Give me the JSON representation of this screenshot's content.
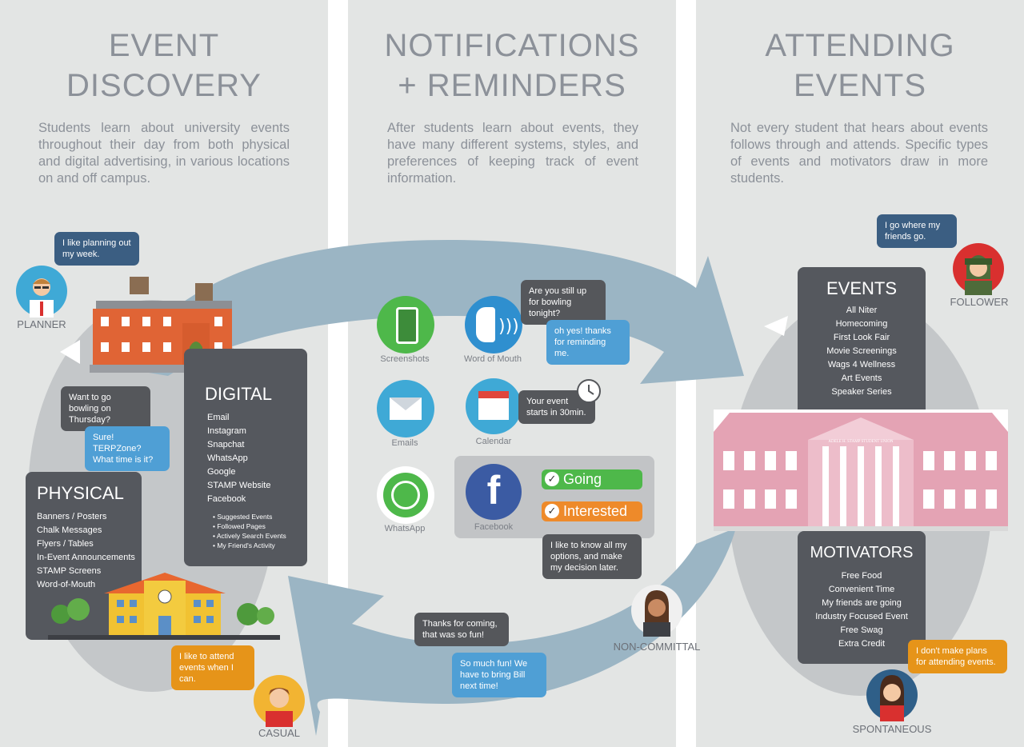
{
  "columns": {
    "discovery": {
      "title_line1": "EVENT",
      "title_line2": "DISCOVERY",
      "description": "Students learn about university events throughout their day from both physical and digital advertising, in various locations on and off campus."
    },
    "notifications": {
      "title_line1": "NOTIFICATIONS",
      "title_line2": "+ REMINDERS",
      "description": "After students learn about events, they have many different systems, styles, and preferences of keeping track of event information."
    },
    "attending": {
      "title_line1": "ATTENDING",
      "title_line2": "EVENTS",
      "description": "Not every student that hears about events follows through and attends. Specific types of events and motivators draw in more students."
    }
  },
  "personas": {
    "planner": {
      "label": "PLANNER",
      "quote": "I like planning out my week."
    },
    "casual": {
      "label": "CASUAL",
      "quote": "I like to attend events when I can."
    },
    "follower": {
      "label": "FOLLOWER",
      "quote": "I go where my friends go."
    },
    "spontaneous": {
      "label": "SPONTANEOUS",
      "quote": "I don't make plans for attending events."
    },
    "noncommittal": {
      "label": "NON-COMMITTAL",
      "quote": "I like to know all my options, and make my decision later."
    }
  },
  "conversation": {
    "bowling_question": "Want to go bowling on Thursday?",
    "bowling_answer": "Sure! TERPZone? What time is it?",
    "still_up": "Are you still up for bowling tonight?",
    "reply": "oh yes! thanks for reminding me.",
    "thanks": "Thanks for coming, that was so fun!",
    "so_fun": "So much fun! We have to bring Bill next time!",
    "calendar_reminder": "Your event starts in 30min."
  },
  "digital": {
    "title": "DIGITAL",
    "items": [
      "Email",
      "Instagram",
      "Snapchat",
      "WhatsApp",
      "Google",
      "STAMP Website",
      "Facebook"
    ],
    "facebook_subitems": [
      "• Suggested Events",
      "• Followed Pages",
      "• Actively Search Events",
      "• My Friend's Activity"
    ]
  },
  "physical": {
    "title": "PHYSICAL",
    "items": [
      "Banners / Posters",
      "Chalk Messages",
      "Flyers / Tables",
      "In-Event Announcements",
      "STAMP Screens",
      "Word-of-Mouth"
    ]
  },
  "apps": {
    "screenshots": "Screenshots",
    "word_of_mouth": "Word of Mouth",
    "emails": "Emails",
    "calendar": "Calendar",
    "whatsapp": "WhatsApp",
    "facebook": "Facebook",
    "going": "Going",
    "interested": "Interested"
  },
  "events": {
    "title": "EVENTS",
    "items": [
      "All Niter",
      "Homecoming",
      "First Look Fair",
      "Movie Screenings",
      "Wags 4 Wellness",
      "Art Events",
      "Speaker Series"
    ]
  },
  "motivators": {
    "title": "MOTIVATORS",
    "items": [
      "Free Food",
      "Convenient Time",
      "My friends are going",
      "Industry Focused Event",
      "Free Swag",
      "Extra Credit"
    ]
  },
  "building_sign": "ADELE H. STAMP STUDENT UNION",
  "colors": {
    "panel": "#e3e5e4",
    "arrow": "#9bb5c4",
    "box": "#55585e",
    "bubble_dark": "#55575b",
    "bubble_blue": "#4f9fd5",
    "bubble_orange": "#e69419",
    "stamp_pink": "#e4a3b4",
    "going_green": "#4eb84a",
    "interested_orange": "#ee8a2a"
  }
}
